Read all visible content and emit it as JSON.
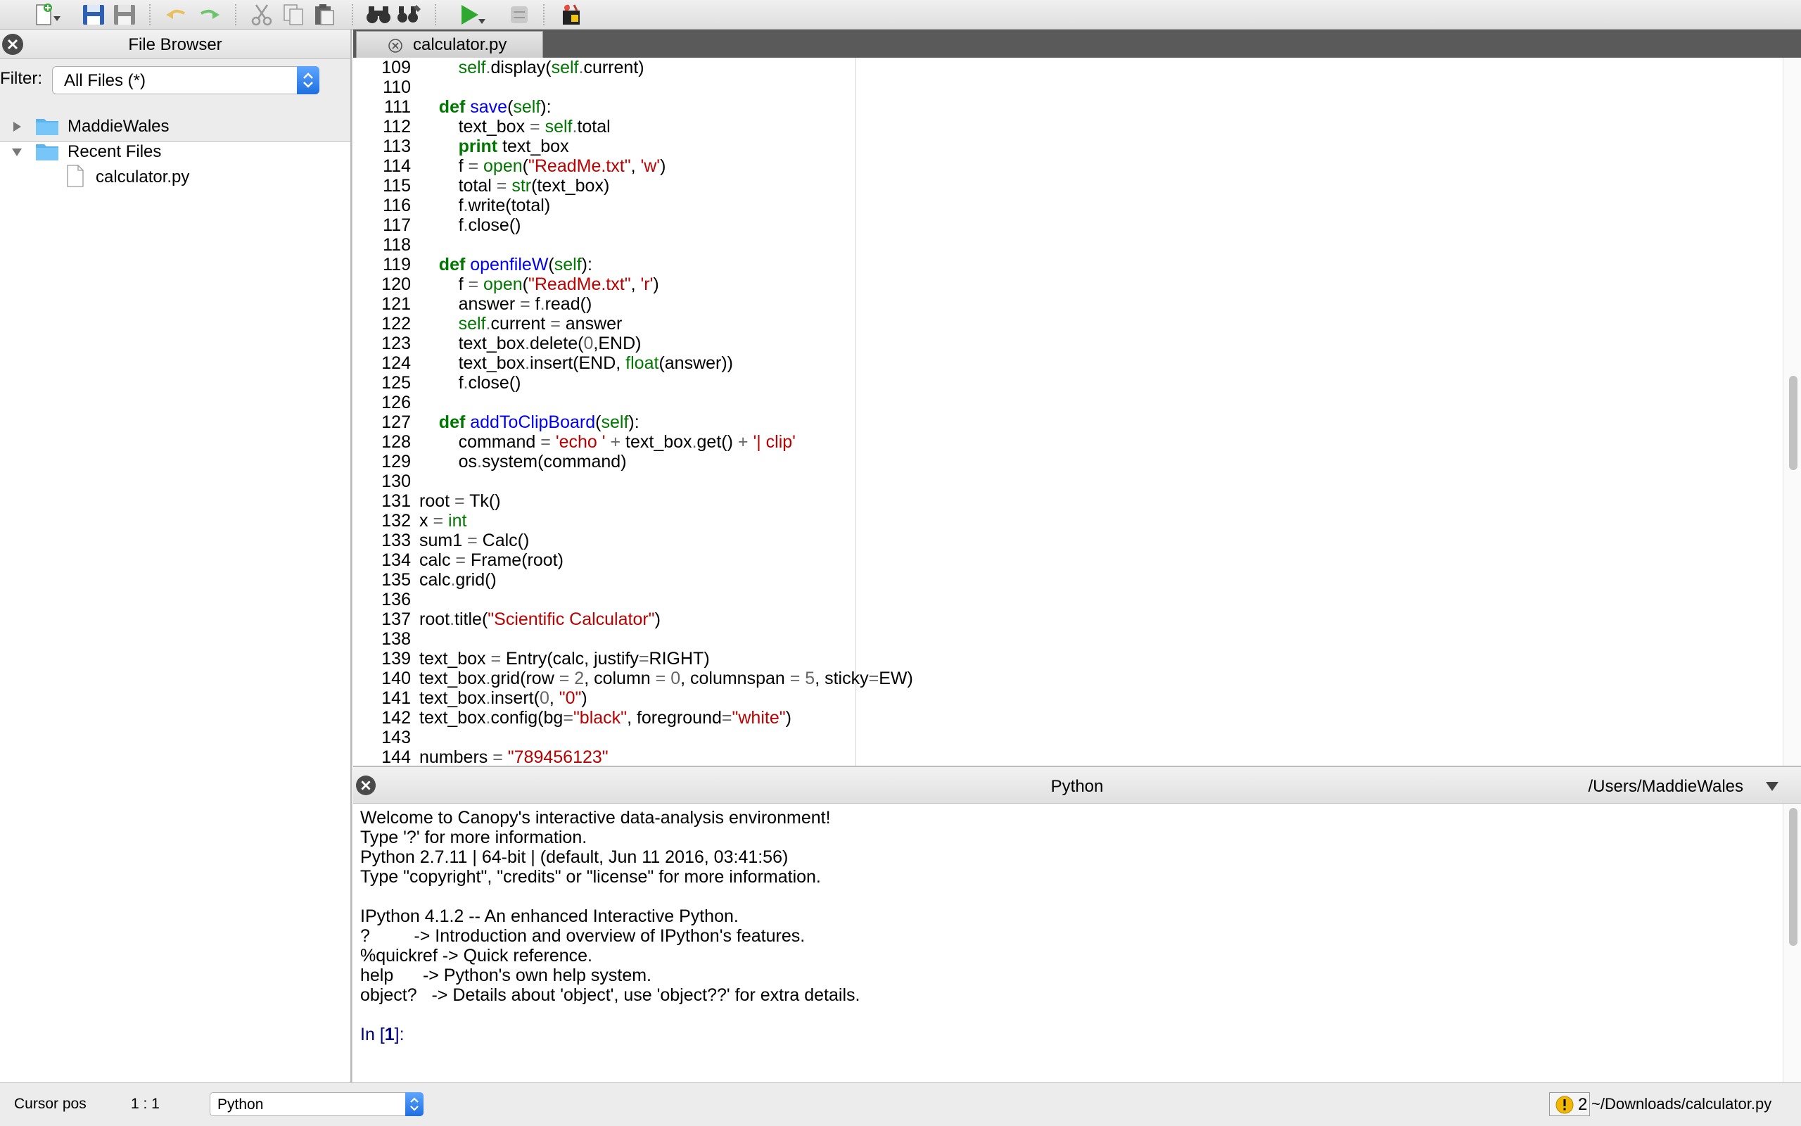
{
  "toolbar": {
    "buttons": [
      {
        "icon": "new-file-icon"
      },
      {
        "icon": "save-icon"
      },
      {
        "icon": "save-all-icon"
      },
      {
        "icon": "undo-icon"
      },
      {
        "icon": "redo-icon"
      },
      {
        "icon": "cut-icon"
      },
      {
        "icon": "copy-icon"
      },
      {
        "icon": "paste-icon"
      },
      {
        "icon": "find-icon"
      },
      {
        "icon": "find-replace-icon"
      },
      {
        "icon": "run-icon"
      },
      {
        "icon": "debug-icon"
      },
      {
        "icon": "package-manager-icon"
      }
    ]
  },
  "file_browser": {
    "title": "File Browser",
    "filter_label": "Filter:",
    "filter_value": "All Files (*)",
    "tree": [
      {
        "label": "MaddieWales",
        "type": "folder",
        "expanded": false
      },
      {
        "label": "Recent Files",
        "type": "folder",
        "expanded": true
      },
      {
        "label": "calculator.py",
        "type": "file"
      }
    ]
  },
  "editor": {
    "tabs": [
      {
        "label": "calculator.py",
        "active": true
      }
    ],
    "line_numbers": [
      "109",
      "110",
      "111",
      "112",
      "113",
      "114",
      "115",
      "116",
      "117",
      "118",
      "119",
      "120",
      "121",
      "122",
      "123",
      "124",
      "125",
      "126",
      "127",
      "128",
      "129",
      "130",
      "131",
      "132",
      "133",
      "134",
      "135",
      "136",
      "137",
      "138",
      "139",
      "140",
      "141",
      "142",
      "143",
      "144"
    ],
    "code_lines": [
      [
        [
          "",
          "        "
        ],
        [
          "bi",
          "self"
        ],
        [
          "op",
          "."
        ],
        [
          "",
          "display("
        ],
        [
          "bi",
          "self"
        ],
        [
          "op",
          "."
        ],
        [
          "",
          "current)"
        ]
      ],
      [],
      [
        [
          "",
          "    "
        ],
        [
          "kw",
          "def"
        ],
        [
          "",
          " "
        ],
        [
          "fn",
          "save"
        ],
        [
          "",
          "("
        ],
        [
          "bi",
          "self"
        ],
        [
          "",
          "):"
        ]
      ],
      [
        [
          "",
          "        text_box "
        ],
        [
          "op",
          "="
        ],
        [
          "",
          " "
        ],
        [
          "bi",
          "self"
        ],
        [
          "op",
          "."
        ],
        [
          "",
          "total"
        ]
      ],
      [
        [
          "",
          "        "
        ],
        [
          "kw",
          "print"
        ],
        [
          "",
          " text_box"
        ]
      ],
      [
        [
          "",
          "        f "
        ],
        [
          "op",
          "="
        ],
        [
          "",
          " "
        ],
        [
          "bi",
          "open"
        ],
        [
          "",
          "("
        ],
        [
          "st",
          "\"ReadMe.txt\""
        ],
        [
          "",
          ", "
        ],
        [
          "st",
          "'w'"
        ],
        [
          "",
          ")"
        ]
      ],
      [
        [
          "",
          "        total "
        ],
        [
          "op",
          "="
        ],
        [
          "",
          " "
        ],
        [
          "bi",
          "str"
        ],
        [
          "",
          "(text_box)"
        ]
      ],
      [
        [
          "",
          "        f"
        ],
        [
          "op",
          "."
        ],
        [
          "",
          "write(total)"
        ]
      ],
      [
        [
          "",
          "        f"
        ],
        [
          "op",
          "."
        ],
        [
          "",
          "close()"
        ]
      ],
      [],
      [
        [
          "",
          "    "
        ],
        [
          "kw",
          "def"
        ],
        [
          "",
          " "
        ],
        [
          "fn",
          "openfileW"
        ],
        [
          "",
          "("
        ],
        [
          "bi",
          "self"
        ],
        [
          "",
          "):"
        ]
      ],
      [
        [
          "",
          "        f "
        ],
        [
          "op",
          "="
        ],
        [
          "",
          " "
        ],
        [
          "bi",
          "open"
        ],
        [
          "",
          "("
        ],
        [
          "st",
          "\"ReadMe.txt\""
        ],
        [
          "",
          ", "
        ],
        [
          "st",
          "'r'"
        ],
        [
          "",
          ")"
        ]
      ],
      [
        [
          "",
          "        answer "
        ],
        [
          "op",
          "="
        ],
        [
          "",
          " f"
        ],
        [
          "op",
          "."
        ],
        [
          "",
          "read()"
        ]
      ],
      [
        [
          "",
          "        "
        ],
        [
          "bi",
          "self"
        ],
        [
          "op",
          "."
        ],
        [
          "",
          "current "
        ],
        [
          "op",
          "="
        ],
        [
          "",
          " answer"
        ]
      ],
      [
        [
          "",
          "        text_box"
        ],
        [
          "op",
          "."
        ],
        [
          "",
          "delete("
        ],
        [
          "nm",
          "0"
        ],
        [
          "",
          ",END)"
        ]
      ],
      [
        [
          "",
          "        text_box"
        ],
        [
          "op",
          "."
        ],
        [
          "",
          "insert(END, "
        ],
        [
          "bi",
          "float"
        ],
        [
          "",
          "(answer))"
        ]
      ],
      [
        [
          "",
          "        f"
        ],
        [
          "op",
          "."
        ],
        [
          "",
          "close()"
        ]
      ],
      [],
      [
        [
          "",
          "    "
        ],
        [
          "kw",
          "def"
        ],
        [
          "",
          " "
        ],
        [
          "fn",
          "addToClipBoard"
        ],
        [
          "",
          "("
        ],
        [
          "bi",
          "self"
        ],
        [
          "",
          "):"
        ]
      ],
      [
        [
          "",
          "        command "
        ],
        [
          "op",
          "="
        ],
        [
          "",
          " "
        ],
        [
          "st",
          "'echo '"
        ],
        [
          "",
          " "
        ],
        [
          "op",
          "+"
        ],
        [
          "",
          " text_box"
        ],
        [
          "op",
          "."
        ],
        [
          "",
          "get() "
        ],
        [
          "op",
          "+"
        ],
        [
          "",
          " "
        ],
        [
          "st",
          "'| clip'"
        ]
      ],
      [
        [
          "",
          "        os"
        ],
        [
          "op",
          "."
        ],
        [
          "",
          "system(command)"
        ]
      ],
      [],
      [
        [
          "",
          "root "
        ],
        [
          "op",
          "="
        ],
        [
          "",
          " Tk()"
        ]
      ],
      [
        [
          "",
          "x "
        ],
        [
          "op",
          "="
        ],
        [
          "",
          " "
        ],
        [
          "bi",
          "int"
        ]
      ],
      [
        [
          "",
          "sum1 "
        ],
        [
          "op",
          "="
        ],
        [
          "",
          " Calc()"
        ]
      ],
      [
        [
          "",
          "calc "
        ],
        [
          "op",
          "="
        ],
        [
          "",
          " Frame(root)"
        ]
      ],
      [
        [
          "",
          "calc"
        ],
        [
          "op",
          "."
        ],
        [
          "",
          "grid()"
        ]
      ],
      [],
      [
        [
          "",
          "root"
        ],
        [
          "op",
          "."
        ],
        [
          "",
          "title("
        ],
        [
          "st",
          "\"Scientific Calculator\""
        ],
        [
          "",
          ")"
        ]
      ],
      [],
      [
        [
          "",
          "text_box "
        ],
        [
          "op",
          "="
        ],
        [
          "",
          " Entry(calc, justify"
        ],
        [
          "op",
          "="
        ],
        [
          "",
          "RIGHT)"
        ]
      ],
      [
        [
          "",
          "text_box"
        ],
        [
          "op",
          "."
        ],
        [
          "",
          "grid(row "
        ],
        [
          "op",
          "="
        ],
        [
          "",
          " "
        ],
        [
          "nm",
          "2"
        ],
        [
          "",
          ", column "
        ],
        [
          "op",
          "="
        ],
        [
          "",
          " "
        ],
        [
          "nm",
          "0"
        ],
        [
          "",
          ", columnspan "
        ],
        [
          "op",
          "="
        ],
        [
          "",
          " "
        ],
        [
          "nm",
          "5"
        ],
        [
          "",
          ", sticky"
        ],
        [
          "op",
          "="
        ],
        [
          "",
          "EW)"
        ]
      ],
      [
        [
          "",
          "text_box"
        ],
        [
          "op",
          "."
        ],
        [
          "",
          "insert("
        ],
        [
          "nm",
          "0"
        ],
        [
          "",
          ", "
        ],
        [
          "st",
          "\"0\""
        ],
        [
          "",
          ")"
        ]
      ],
      [
        [
          "",
          "text_box"
        ],
        [
          "op",
          "."
        ],
        [
          "",
          "config(bg"
        ],
        [
          "op",
          "="
        ],
        [
          "st",
          "\"black\""
        ],
        [
          "",
          ", foreground"
        ],
        [
          "op",
          "="
        ],
        [
          "st",
          "\"white\""
        ],
        [
          "",
          ")"
        ]
      ],
      [],
      [
        [
          "",
          "numbers "
        ],
        [
          "op",
          "="
        ],
        [
          "",
          " "
        ],
        [
          "st",
          "\"789456123\""
        ]
      ]
    ]
  },
  "console": {
    "title": "Python",
    "path": "/Users/MaddieWales",
    "lines": [
      "Welcome to Canopy's interactive data-analysis environment!",
      "Type '?' for more information.",
      "Python 2.7.11 | 64-bit | (default, Jun 11 2016, 03:41:56)",
      "Type \"copyright\", \"credits\" or \"license\" for more information.",
      "",
      "IPython 4.1.2 -- An enhanced Interactive Python.",
      "?         -> Introduction and overview of IPython's features.",
      "%quickref -> Quick reference.",
      "help      -> Python's own help system.",
      "object?   -> Details about 'object', use 'object??' for extra details.",
      ""
    ],
    "prompt_prefix": "In [",
    "prompt_number": "1",
    "prompt_suffix": "]:"
  },
  "statusbar": {
    "cursor_label": "Cursor pos",
    "cursor_value": "1 : 1",
    "language": "Python",
    "warning_count": "2",
    "file_path": "~/Downloads/calculator.py"
  }
}
